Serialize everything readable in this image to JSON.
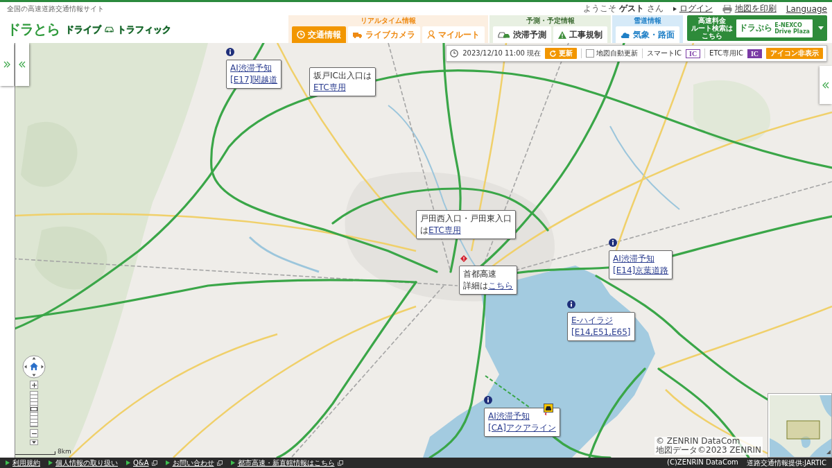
{
  "header": {
    "tagline": "全国の高速道路交通情報サイト",
    "logo": "ドラとら",
    "logo_tagline": [
      "ドライブ",
      "トラフィック"
    ],
    "welcome": "ようこそ **ゲスト** さん",
    "login": "ログイン",
    "print": "地図を印刷",
    "language": "Language"
  },
  "nav": [
    {
      "title": "リアルタイム情報",
      "tabs": [
        {
          "label": "交通情報",
          "selected": true
        },
        {
          "label": "ライブカメラ",
          "selected": false
        },
        {
          "label": "マイルート",
          "selected": false
        }
      ]
    },
    {
      "title": "予測・予定情報",
      "tabs": [
        {
          "label": "渋滞予測",
          "selected": false
        },
        {
          "label": "工事規制",
          "selected": false
        }
      ]
    },
    {
      "title": "雪道情報",
      "tabs": [
        {
          "label": "気象・路面",
          "selected": false
        }
      ]
    }
  ],
  "route_search": {
    "lines": [
      "高速料金",
      "ルート検索は",
      "こちら"
    ],
    "brand": "ドラぷら",
    "brand_sub": [
      "E-NEXCO",
      "Drive Plaza"
    ]
  },
  "toolbar": {
    "timestamp": "2023/12/10 11:00 現在",
    "refresh": "更新",
    "auto_update": {
      "label": "地図自動更新",
      "checked": false
    },
    "legend": [
      {
        "label": "スマートIC",
        "badge": "IC",
        "kind": "outline"
      },
      {
        "label": "ETC専用IC",
        "badge": "IC",
        "kind": "filled"
      }
    ],
    "hide_icons": "アイコン非表示"
  },
  "popups": [
    {
      "kind": "info",
      "lines": [
        [
          {
            "text": "AI渋滞予知",
            "link": true
          }
        ],
        [
          {
            "text": "[E17]関越道",
            "link": true
          }
        ]
      ]
    },
    {
      "kind": "note",
      "lines": [
        [
          {
            "text": "坂戸IC出入口は",
            "link": false
          }
        ],
        [
          {
            "text": "ETC専用",
            "link": true
          }
        ]
      ]
    },
    {
      "kind": "note",
      "lines": [
        [
          {
            "text": "戸田西入口・戸田東入口",
            "link": false
          }
        ],
        [
          {
            "text": "は",
            "link": false
          },
          {
            "text": "ETC専用",
            "link": true
          }
        ]
      ]
    },
    {
      "kind": "alert",
      "lines": [
        [
          {
            "text": "首都高速",
            "link": false
          }
        ],
        [
          {
            "text": "詳細は",
            "link": false
          },
          {
            "text": "こちら",
            "link": true
          }
        ]
      ]
    },
    {
      "kind": "info",
      "lines": [
        [
          {
            "text": "AI渋滞予知",
            "link": true
          }
        ],
        [
          {
            "text": "[E14]京葉道路",
            "link": true
          }
        ]
      ]
    },
    {
      "kind": "info",
      "lines": [
        [
          {
            "text": "E-ハイラジ",
            "link": true
          }
        ],
        [
          {
            "text": "[E14,E51,E65]",
            "link": true
          }
        ]
      ]
    },
    {
      "kind": "info",
      "lines": [
        [
          {
            "text": "AI渋滞予知",
            "link": true
          }
        ],
        [
          {
            "text": "[CA]アクアライン",
            "link": true
          }
        ]
      ]
    }
  ],
  "map_controls": {
    "zoom": {
      "level": 0.5
    },
    "scale": "8km",
    "attribution": [
      "© ZENRIN DataCom",
      "地図データ©2023 ZENRIN"
    ]
  },
  "footer": {
    "links": [
      {
        "label": "利用規約",
        "external": false
      },
      {
        "label": "個人情報の取り扱い",
        "external": false
      },
      {
        "label": "Q&A",
        "external": true
      },
      {
        "label": "お問い合わせ",
        "external": true
      },
      {
        "label": "都市高速・新直轄情報はこちら",
        "external": true
      }
    ],
    "credits": [
      "(C)ZENRIN DataCom",
      "道路交通情報提供:JARTIC"
    ]
  }
}
